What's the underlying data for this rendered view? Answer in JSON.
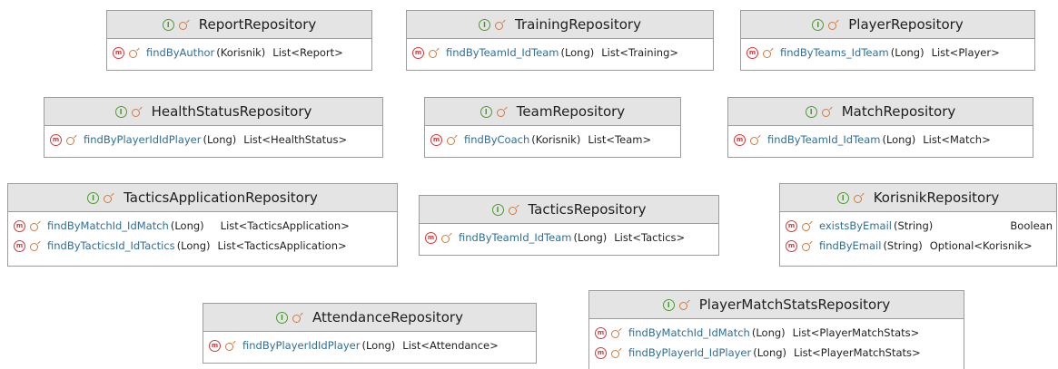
{
  "icons": {
    "interface": "interface-icon",
    "public": "public-visibility-icon",
    "method": "method-icon"
  },
  "colors": {
    "interface_icon": "#4e9a32",
    "public_icon": "#cf7a3d",
    "method_icon": "#d23a3a",
    "method_name": "#2f6f98",
    "header_bg": "#e4e4e4"
  },
  "icon_glyphs": {
    "interface": "I",
    "method": "m"
  },
  "repositories": [
    {
      "name": "ReportRepository",
      "methods": [
        {
          "name": "findByAuthor",
          "params": "(Korisnik)",
          "returns": "List<Report>"
        }
      ]
    },
    {
      "name": "TrainingRepository",
      "methods": [
        {
          "name": "findByTeamId_IdTeam",
          "params": "(Long)",
          "returns": "List<Training>"
        }
      ]
    },
    {
      "name": "PlayerRepository",
      "methods": [
        {
          "name": "findByTeams_IdTeam",
          "params": "(Long)",
          "returns": "List<Player>"
        }
      ]
    },
    {
      "name": "HealthStatusRepository",
      "methods": [
        {
          "name": "findByPlayerIdIdPlayer",
          "params": "(Long)",
          "returns": "List<HealthStatus>"
        }
      ]
    },
    {
      "name": "TeamRepository",
      "methods": [
        {
          "name": "findByCoach",
          "params": "(Korisnik)",
          "returns": "List<Team>"
        }
      ]
    },
    {
      "name": "MatchRepository",
      "methods": [
        {
          "name": "findByTeamId_IdTeam",
          "params": "(Long)",
          "returns": "List<Match>"
        }
      ]
    },
    {
      "name": "TacticsApplicationRepository",
      "methods": [
        {
          "name": "findByMatchId_IdMatch",
          "params": "(Long)",
          "returns": "List<TacticsApplication>"
        },
        {
          "name": "findByTacticsId_IdTactics",
          "params": "(Long)",
          "returns": "List<TacticsApplication>"
        }
      ]
    },
    {
      "name": "TacticsRepository",
      "methods": [
        {
          "name": "findByTeamId_IdTeam",
          "params": "(Long)",
          "returns": "List<Tactics>"
        }
      ]
    },
    {
      "name": "KorisnikRepository",
      "methods": [
        {
          "name": "existsByEmail",
          "params": "(String)",
          "returns": "Boolean"
        },
        {
          "name": "findByEmail",
          "params": "(String)",
          "returns": "Optional<Korisnik>"
        }
      ]
    },
    {
      "name": "AttendanceRepository",
      "methods": [
        {
          "name": "findByPlayerIdIdPlayer",
          "params": "(Long)",
          "returns": "List<Attendance>"
        }
      ]
    },
    {
      "name": "PlayerMatchStatsRepository",
      "methods": [
        {
          "name": "findByMatchId_IdMatch",
          "params": "(Long)",
          "returns": "List<PlayerMatchStats>"
        },
        {
          "name": "findByPlayerId_IdPlayer",
          "params": "(Long)",
          "returns": "List<PlayerMatchStats>"
        }
      ]
    }
  ]
}
